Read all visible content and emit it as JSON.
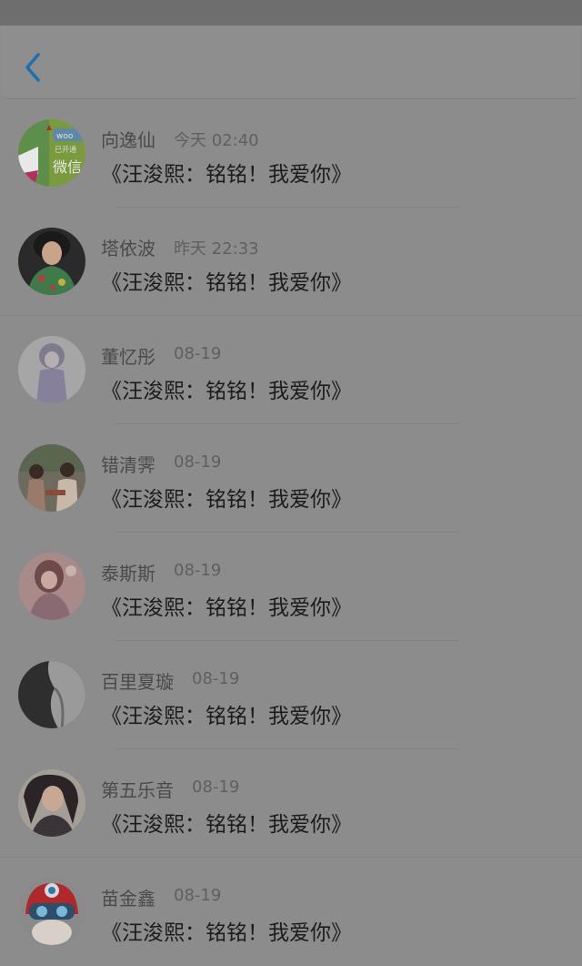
{
  "nav": {
    "back_icon": "chevron-left-icon",
    "accent_color": "#1e6fb0"
  },
  "messages": [
    {
      "name": "向逸仙",
      "time": "今天 02:40",
      "text": "《汪浚熙：铭铭！我爱你》"
    },
    {
      "name": "塔依波",
      "time": "昨天 22:33",
      "text": "《汪浚熙：铭铭！我爱你》"
    },
    {
      "name": "董忆彤",
      "time": "08-19",
      "text": "《汪浚熙：铭铭！我爱你》"
    },
    {
      "name": "错清霁",
      "time": "08-19",
      "text": "《汪浚熙：铭铭！我爱你》"
    },
    {
      "name": "泰斯斯",
      "time": "08-19",
      "text": "《汪浚熙：铭铭！我爱你》"
    },
    {
      "name": "百里夏璇",
      "time": "08-19",
      "text": "《汪浚熙：铭铭！我爱你》"
    },
    {
      "name": "第五乐音",
      "time": "08-19",
      "text": "《汪浚熙：铭铭！我爱你》"
    },
    {
      "name": "苗金鑫",
      "time": "08-19",
      "text": "《汪浚熙：铭铭！我爱你》"
    }
  ],
  "avatar_logo": {
    "line1": "woo",
    "line2": "已开通",
    "line3": "微信"
  }
}
